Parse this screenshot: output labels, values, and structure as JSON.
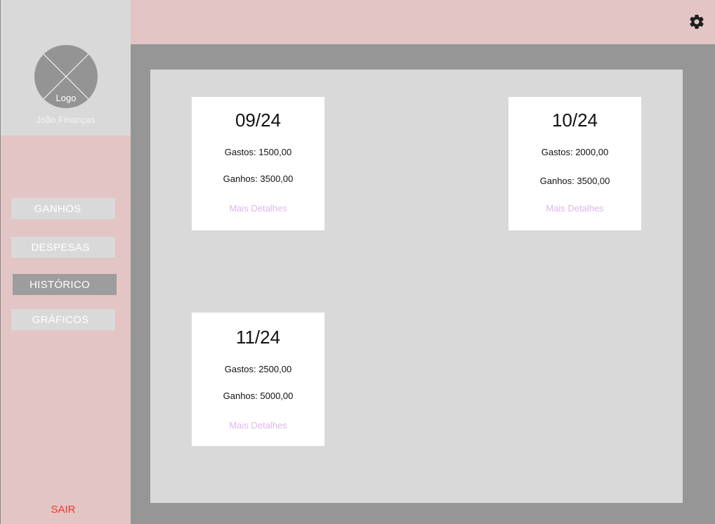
{
  "brand": {
    "logo_text": "Logo",
    "name": "João Finanças"
  },
  "sidebar": {
    "items": [
      {
        "label": "GANHOS",
        "active": false
      },
      {
        "label": "DESPESAS",
        "active": false
      },
      {
        "label": "HISTÓRICO",
        "active": true
      },
      {
        "label": "GRÁFICOS",
        "active": false
      }
    ],
    "logout_label": "SAIR"
  },
  "topbar": {
    "settings_icon": "gear-icon"
  },
  "history": {
    "cards": [
      {
        "period": "09/24",
        "expenses": "Gastos: 1500,00",
        "income": "Ganhos: 3500,00",
        "details_label": "Mais Detalhes"
      },
      {
        "period": "10/24",
        "expenses": "Gastos: 2000,00",
        "income": "Ganhos: 3500,00",
        "details_label": "Mais Detalhes"
      },
      {
        "period": "11/24",
        "expenses": "Gastos: 2500,00",
        "income": "Ganhos: 5000,00",
        "details_label": "Mais Detalhes"
      }
    ]
  },
  "colors": {
    "sidebar_bg": "#e3c5c6",
    "brand_bg": "#d9d9d9",
    "content_bg": "#d9d9d9",
    "frame_bg": "#969696",
    "active_nav_bg": "#9d9d9d",
    "link": "#dcb6eb",
    "logout": "#f2352b"
  }
}
